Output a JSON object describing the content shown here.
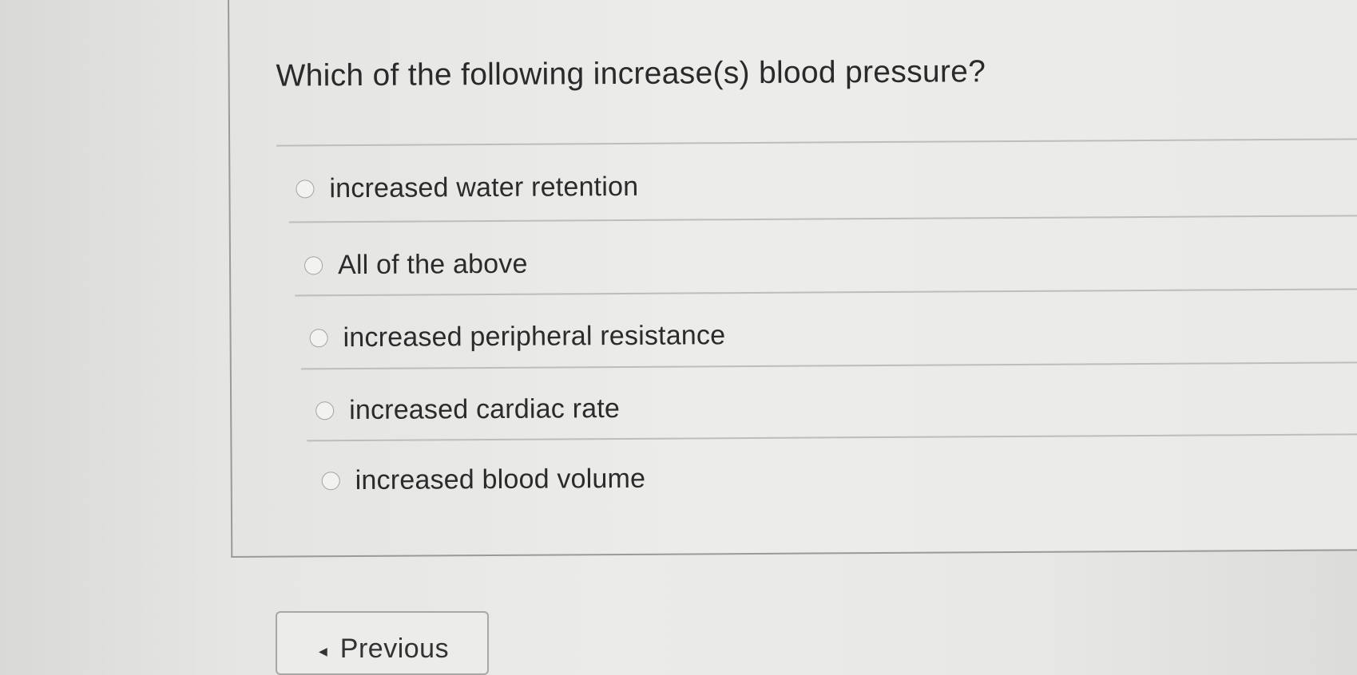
{
  "question": {
    "text": "Which of the following increase(s) blood pressure?"
  },
  "options": [
    {
      "label": "increased water retention",
      "selected": false
    },
    {
      "label": "All of the above",
      "selected": false
    },
    {
      "label": "increased peripheral resistance",
      "selected": false
    },
    {
      "label": "increased cardiac rate",
      "selected": false
    },
    {
      "label": "increased blood volume",
      "selected": false
    }
  ],
  "navigation": {
    "previous_label": "Previous",
    "previous_icon": "triangle-left-icon"
  }
}
